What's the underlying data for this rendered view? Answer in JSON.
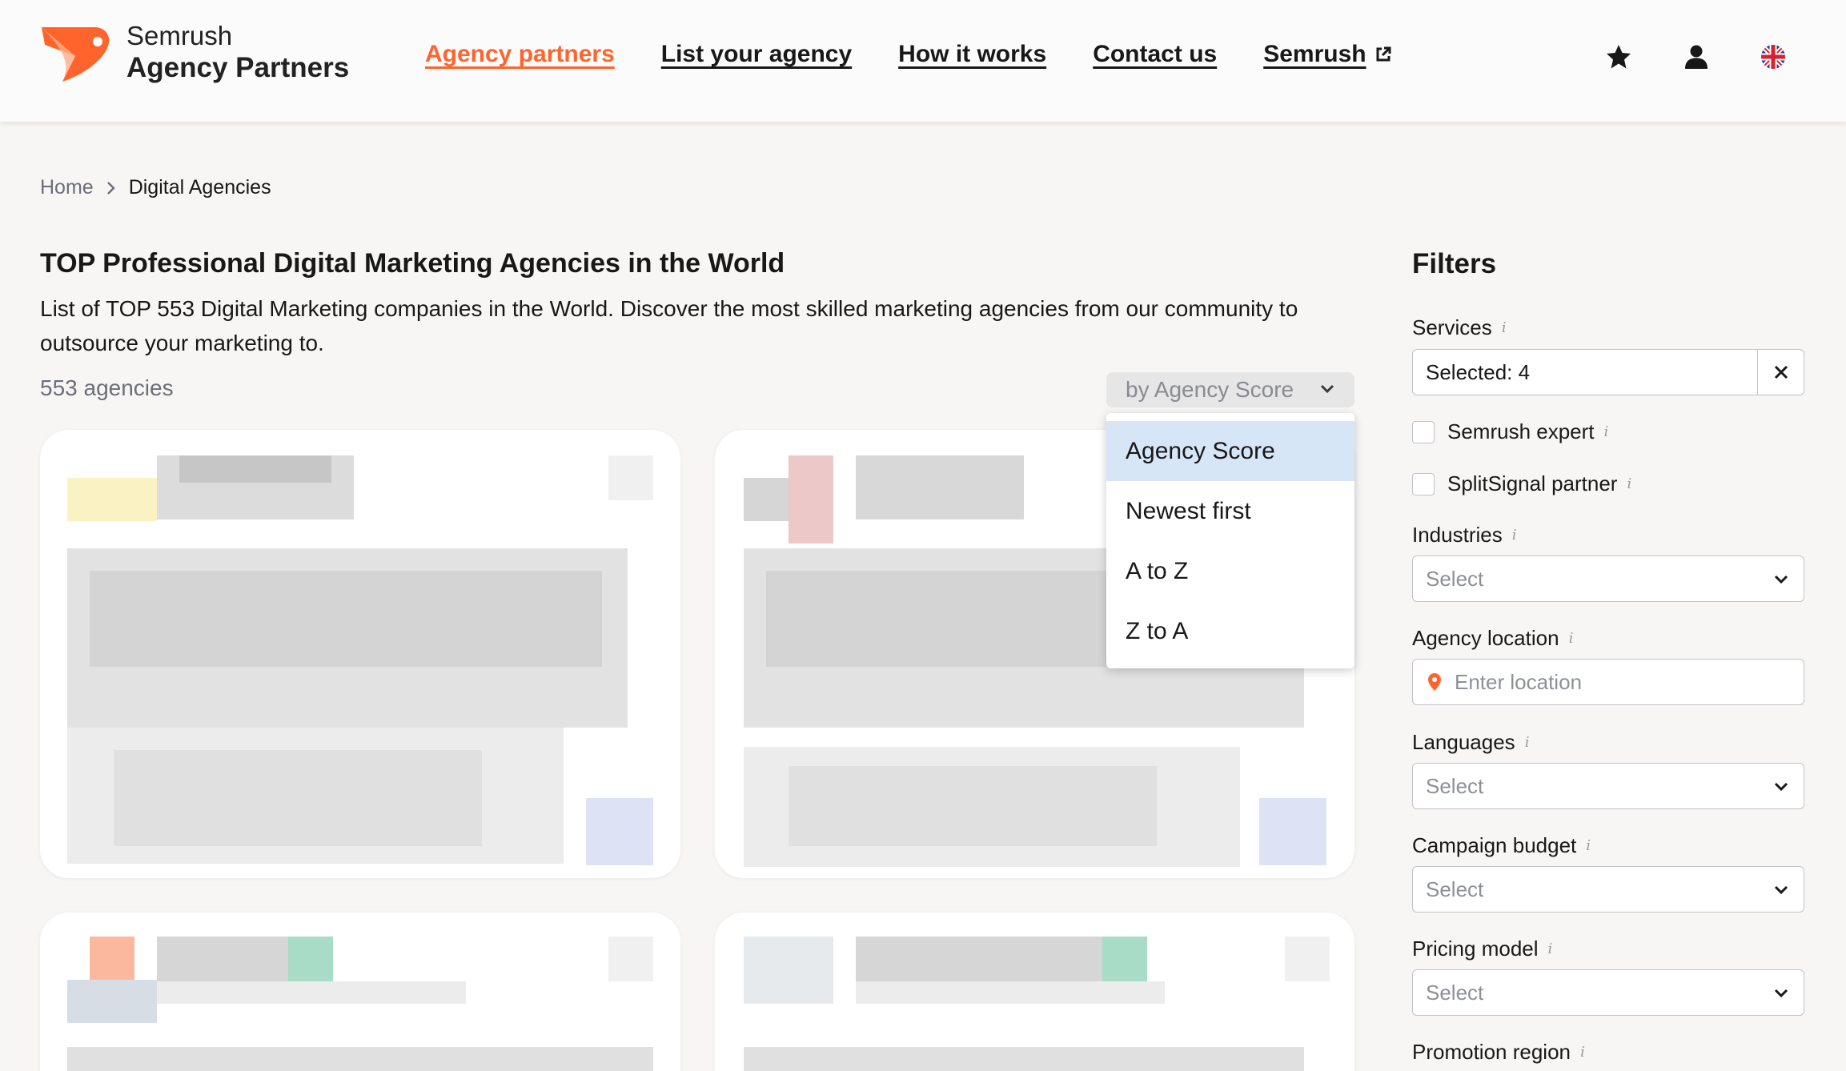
{
  "brand": {
    "line1": "Semrush",
    "line2": "Agency Partners",
    "accent": "#ff642d"
  },
  "nav": {
    "items": [
      {
        "label": "Agency partners",
        "active": true
      },
      {
        "label": "List your agency"
      },
      {
        "label": "How it works"
      },
      {
        "label": "Contact us"
      },
      {
        "label": "Semrush",
        "external": true
      }
    ]
  },
  "header_icons": [
    "star-icon",
    "user-icon",
    "uk-flag-icon"
  ],
  "breadcrumb": {
    "home": "Home",
    "current": "Digital Agencies"
  },
  "page": {
    "title": "TOP Professional Digital Marketing Agencies in the World",
    "description": "List of TOP 553 Digital Marketing companies in the World. Discover the most skilled marketing agencies from our community to outsource your marketing to.",
    "count": "553 agencies"
  },
  "sort": {
    "current": "by Agency Score",
    "options": [
      "Agency Score",
      "Newest first",
      "A to Z",
      "Z to A"
    ],
    "selected_index": 0,
    "selected_color": "#d7e6f7"
  },
  "filters": {
    "title": "Filters",
    "services": {
      "label": "Services",
      "value": "Selected: 4"
    },
    "semrush_expert": {
      "label": "Semrush expert",
      "checked": false
    },
    "splitsignal": {
      "label": "SplitSignal partner",
      "checked": false
    },
    "industries": {
      "label": "Industries",
      "placeholder": "Select"
    },
    "location": {
      "label": "Agency location",
      "placeholder": "Enter location"
    },
    "languages": {
      "label": "Languages",
      "placeholder": "Select"
    },
    "budget": {
      "label": "Campaign budget",
      "placeholder": "Select"
    },
    "pricing": {
      "label": "Pricing model",
      "placeholder": "Select"
    },
    "region": {
      "label": "Promotion region"
    }
  }
}
